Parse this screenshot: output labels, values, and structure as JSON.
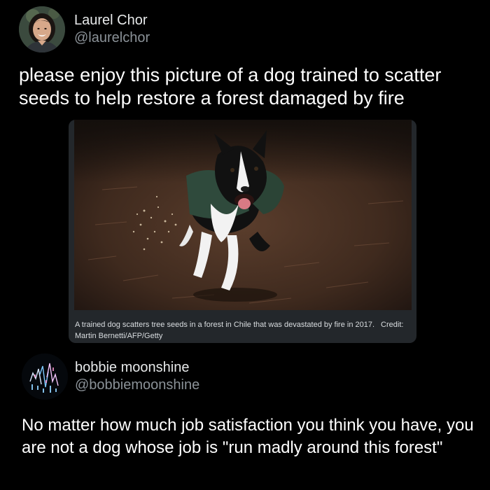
{
  "tweet_1": {
    "author": {
      "name": "Laurel Chor",
      "handle": "@laurelchor",
      "avatar": "profile-photo-woman"
    },
    "text": "please enjoy this picture of a dog trained to scatter seeds to help restore a forest damaged by fire",
    "media": {
      "image": "border-collie-running-scattering-seeds-in-burnt-forest",
      "caption": "A trained dog scatters tree seeds in a forest in Chile that was devastated by fire in 2017.",
      "credit": "Credit: Martin Bernetti/AFP/Getty"
    }
  },
  "tweet_2": {
    "author": {
      "name": "bobbie moonshine",
      "handle": "@bobbiemoonshine",
      "avatar": "abstract-glitch-art-avatar"
    },
    "text": "No matter how much job satisfaction you think you have, you are not a dog whose job is \"run madly around this forest\""
  },
  "colors": {
    "background": "#000000",
    "primary_text": "#ffffff",
    "secondary_text": "#8b9298",
    "card_background": "#23272b"
  }
}
